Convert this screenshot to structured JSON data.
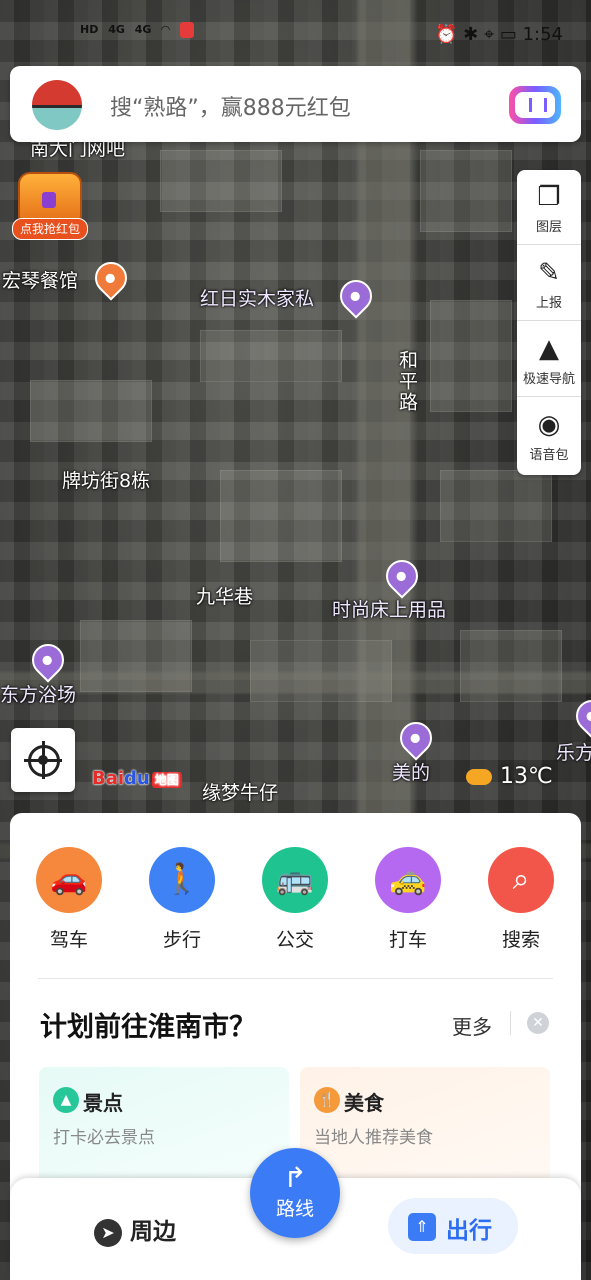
{
  "status_bar": {
    "left_indicators": [
      "HD",
      "4G",
      "4G"
    ],
    "time": "1:54"
  },
  "search": {
    "placeholder": "搜“熟路”，赢888元红包"
  },
  "red_packet": {
    "label": "点我抢红包"
  },
  "tools": [
    {
      "label": "图层",
      "icon": "layers-icon"
    },
    {
      "label": "上报",
      "icon": "report-icon"
    },
    {
      "label": "极速导航",
      "icon": "navigation-icon"
    },
    {
      "label": "语音包",
      "icon": "voice-pack-icon"
    }
  ],
  "map_labels": {
    "top_left_cut": "南大门网吧",
    "restaurant": "宏琴餐馆",
    "furniture": "红日实木家私",
    "road": "和平路",
    "building": "牌坊街8栋",
    "lane": "九华巷",
    "bedding": "时尚床上用品",
    "bath": "东方浴场",
    "meide": "美的",
    "jeans": "缘梦牛仔",
    "right_cut": "乐方"
  },
  "map_brand": {
    "baidu": "Bai",
    "du": "du",
    "maptag": "地图"
  },
  "weather": {
    "temp": "13℃"
  },
  "travel_modes": [
    {
      "label": "驾车",
      "color": "#f5883c",
      "icon": "car-icon"
    },
    {
      "label": "步行",
      "color": "#3f82f5",
      "icon": "walk-icon"
    },
    {
      "label": "公交",
      "color": "#1fc38f",
      "icon": "bus-icon"
    },
    {
      "label": "打车",
      "color": "#b469f0",
      "icon": "taxi-icon"
    },
    {
      "label": "搜索",
      "color": "#f2564a",
      "icon": "search-icon"
    }
  ],
  "plan": {
    "title": "计划前往淮南市？",
    "more": "更多"
  },
  "suggestions": [
    {
      "title": "景点",
      "desc": "打卡必去景点",
      "color": "#28c79a"
    },
    {
      "title": "美食",
      "desc": "当地人推荐美食",
      "color": "#f59a3b"
    }
  ],
  "bottom_nav": {
    "nearby": "周边",
    "route": "路线",
    "go": "出行"
  }
}
